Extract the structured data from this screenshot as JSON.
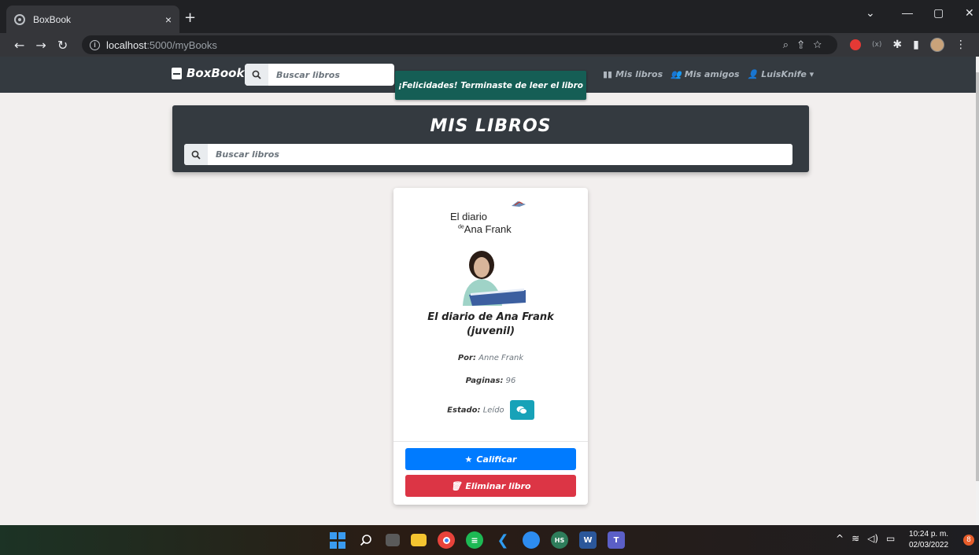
{
  "browser": {
    "tab_title": "BoxBook",
    "tab_close": "×",
    "new_tab": "+",
    "url_host": "localhost",
    "url_path": ":5000/myBooks",
    "win_min": "—",
    "win_max": "▢",
    "win_close": "✕",
    "win_chevron": "⌄"
  },
  "nav": {
    "brand": "BoxBook",
    "search_placeholder": "Buscar libros",
    "link_books": "Mis libros",
    "link_friends": "Mis amigos",
    "link_user": "LuisKnife"
  },
  "toast": {
    "message": "¡Felicidades! Terminaste de leer el libro"
  },
  "panel": {
    "title": "MIS LIBROS",
    "search_placeholder": "Buscar libros"
  },
  "book": {
    "cover_title_1": "El diario",
    "cover_title_2": "Ana Frank",
    "cover_de": "de",
    "title_line1": "El diario de Ana Frank",
    "title_line2": "(juvenil)",
    "by_label": "Por:",
    "author": "Anne Frank",
    "pages_label": "Paginas:",
    "pages": "96",
    "status_label": "Estado:",
    "status": "Leído",
    "rate_button": "Calificar",
    "delete_button": "Eliminar libro"
  },
  "taskbar": {
    "time": "10:24 p. m.",
    "date": "02/03/2022",
    "notifications": "8"
  },
  "colors": {
    "navbar": "#343a40",
    "toast": "#155e55",
    "primary": "#007bff",
    "danger": "#dc3545",
    "info": "#17a2b8"
  }
}
